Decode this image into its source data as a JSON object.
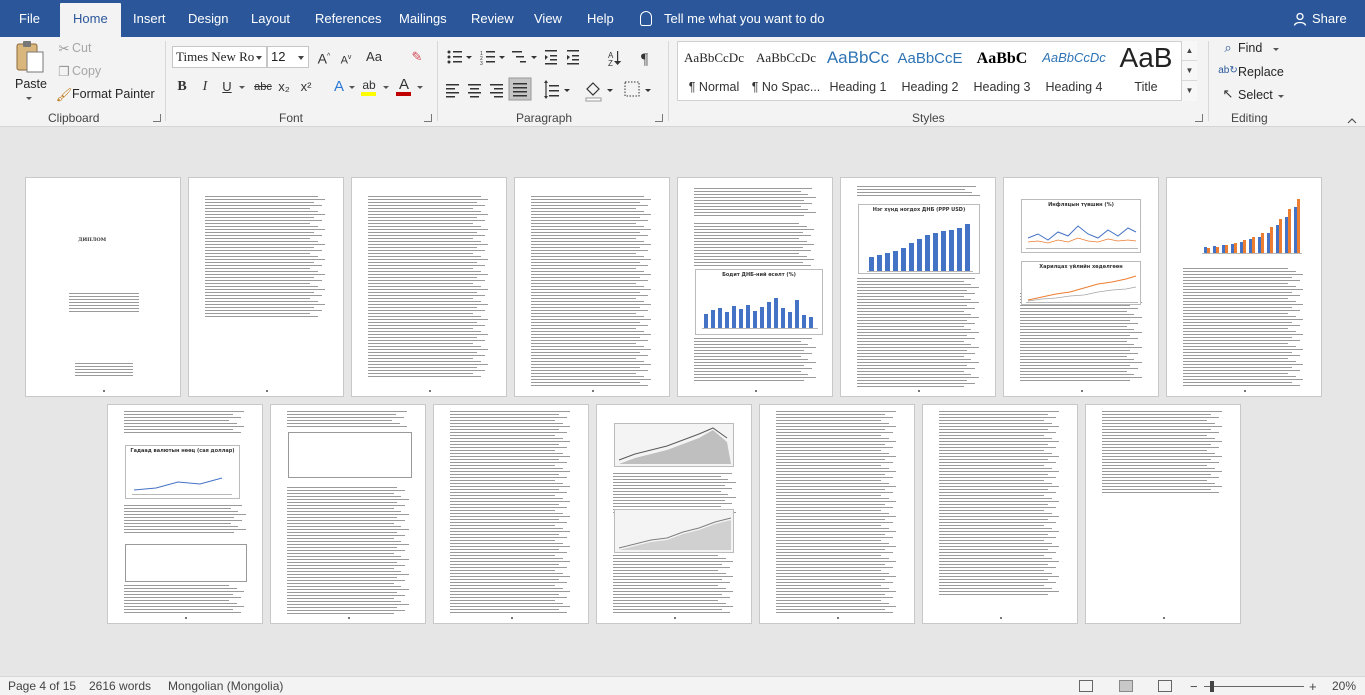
{
  "tabs": {
    "file": "File",
    "home": "Home",
    "insert": "Insert",
    "design": "Design",
    "layout": "Layout",
    "references": "References",
    "mailings": "Mailings",
    "review": "Review",
    "view": "View",
    "help": "Help",
    "tell_me": "Tell me what you want to do",
    "share": "Share"
  },
  "clipboard": {
    "paste": "Paste",
    "cut": "Cut",
    "copy": "Copy",
    "format_painter": "Format Painter",
    "label": "Clipboard"
  },
  "font": {
    "name": "Times New Ro",
    "size": "12",
    "label": "Font",
    "bold": "B",
    "italic": "I",
    "underline": "U",
    "strike": "abc",
    "subscript": "x₂",
    "superscript": "x²",
    "text_effects": "A",
    "highlight": "ab",
    "font_color": "A",
    "grow": "A",
    "shrink": "A"
  },
  "paragraph": {
    "label": "Paragraph"
  },
  "styles": {
    "label": "Styles",
    "items": [
      {
        "sample": "AaBbCcDc",
        "name": "¶ Normal"
      },
      {
        "sample": "AaBbCcDc",
        "name": "¶ No Spac..."
      },
      {
        "sample": "AaBbCc",
        "name": "Heading 1"
      },
      {
        "sample": "AaBbCcE",
        "name": "Heading 2"
      },
      {
        "sample": "AaBbC",
        "name": "Heading 3"
      },
      {
        "sample": "AaBbCcDc",
        "name": "Heading 4"
      },
      {
        "sample": "AaB",
        "name": "Title"
      }
    ]
  },
  "editing": {
    "label": "Editing",
    "find": "Find",
    "replace": "Replace",
    "select": "Select"
  },
  "pages": {
    "p1_title": "ДИПЛОМ",
    "p9_chart_title": "Нэг хүнд ногдох ДНБ (PPP USD)",
    "p5_chart_title": "Бодит ДНБ-ний өсөлт (%)",
    "p7_chart_title": "Инфляцын түвшин (%)",
    "p7_chart2_title": "Харилцах үйлийн хөдөлгөөн",
    "p9b_chart_title": "Гадаад валютын нөөц (сая доллар)"
  },
  "status": {
    "page": "Page 4 of 15",
    "words": "2616 words",
    "language": "Mongolian (Mongolia)",
    "zoom": "20%"
  },
  "colors": {
    "brand": "#2b579a",
    "chart_blue": "#4472c4",
    "chart_orange": "#ed7d31"
  }
}
